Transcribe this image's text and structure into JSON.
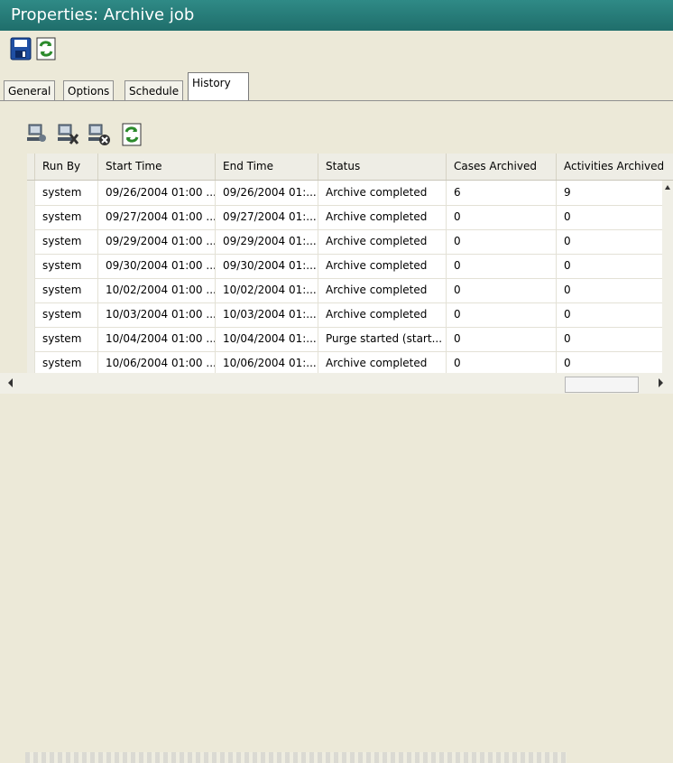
{
  "window": {
    "title": "Properties: Archive job"
  },
  "toolbar": {
    "save_icon": "save-icon",
    "refresh_icon": "refresh-icon"
  },
  "tabs": [
    "General",
    "Options",
    "Schedule",
    "History"
  ],
  "active_tab": "History",
  "grid_toolbar": {
    "icons": [
      "view-icon",
      "delete-icon",
      "cancel-icon",
      "refresh-icon"
    ]
  },
  "grid": {
    "columns": [
      "Run By",
      "Start Time",
      "End Time",
      "Status",
      "Cases Archived",
      "Activities Archived"
    ],
    "rows": [
      [
        "system",
        "09/26/2004 01:00 ...",
        "09/26/2004 01:...",
        "Archive completed",
        "6",
        "9"
      ],
      [
        "system",
        "09/27/2004 01:00 ...",
        "09/27/2004 01:...",
        "Archive completed",
        "0",
        "0"
      ],
      [
        "system",
        "09/29/2004 01:00 ...",
        "09/29/2004 01:...",
        "Archive completed",
        "0",
        "0"
      ],
      [
        "system",
        "09/30/2004 01:00 ...",
        "09/30/2004 01:...",
        "Archive completed",
        "0",
        "0"
      ],
      [
        "system",
        "10/02/2004 01:00 ...",
        "10/02/2004 01:...",
        "Archive completed",
        "0",
        "0"
      ],
      [
        "system",
        "10/03/2004 01:00 ...",
        "10/03/2004 01:...",
        "Archive completed",
        "0",
        "0"
      ],
      [
        "system",
        "10/04/2004 01:00 ...",
        "10/04/2004 01:...",
        "Purge started (start...",
        "0",
        "0"
      ],
      [
        "system",
        "10/06/2004 01:00 ...",
        "10/06/2004 01:...",
        "Archive completed",
        "0",
        "0"
      ]
    ]
  }
}
